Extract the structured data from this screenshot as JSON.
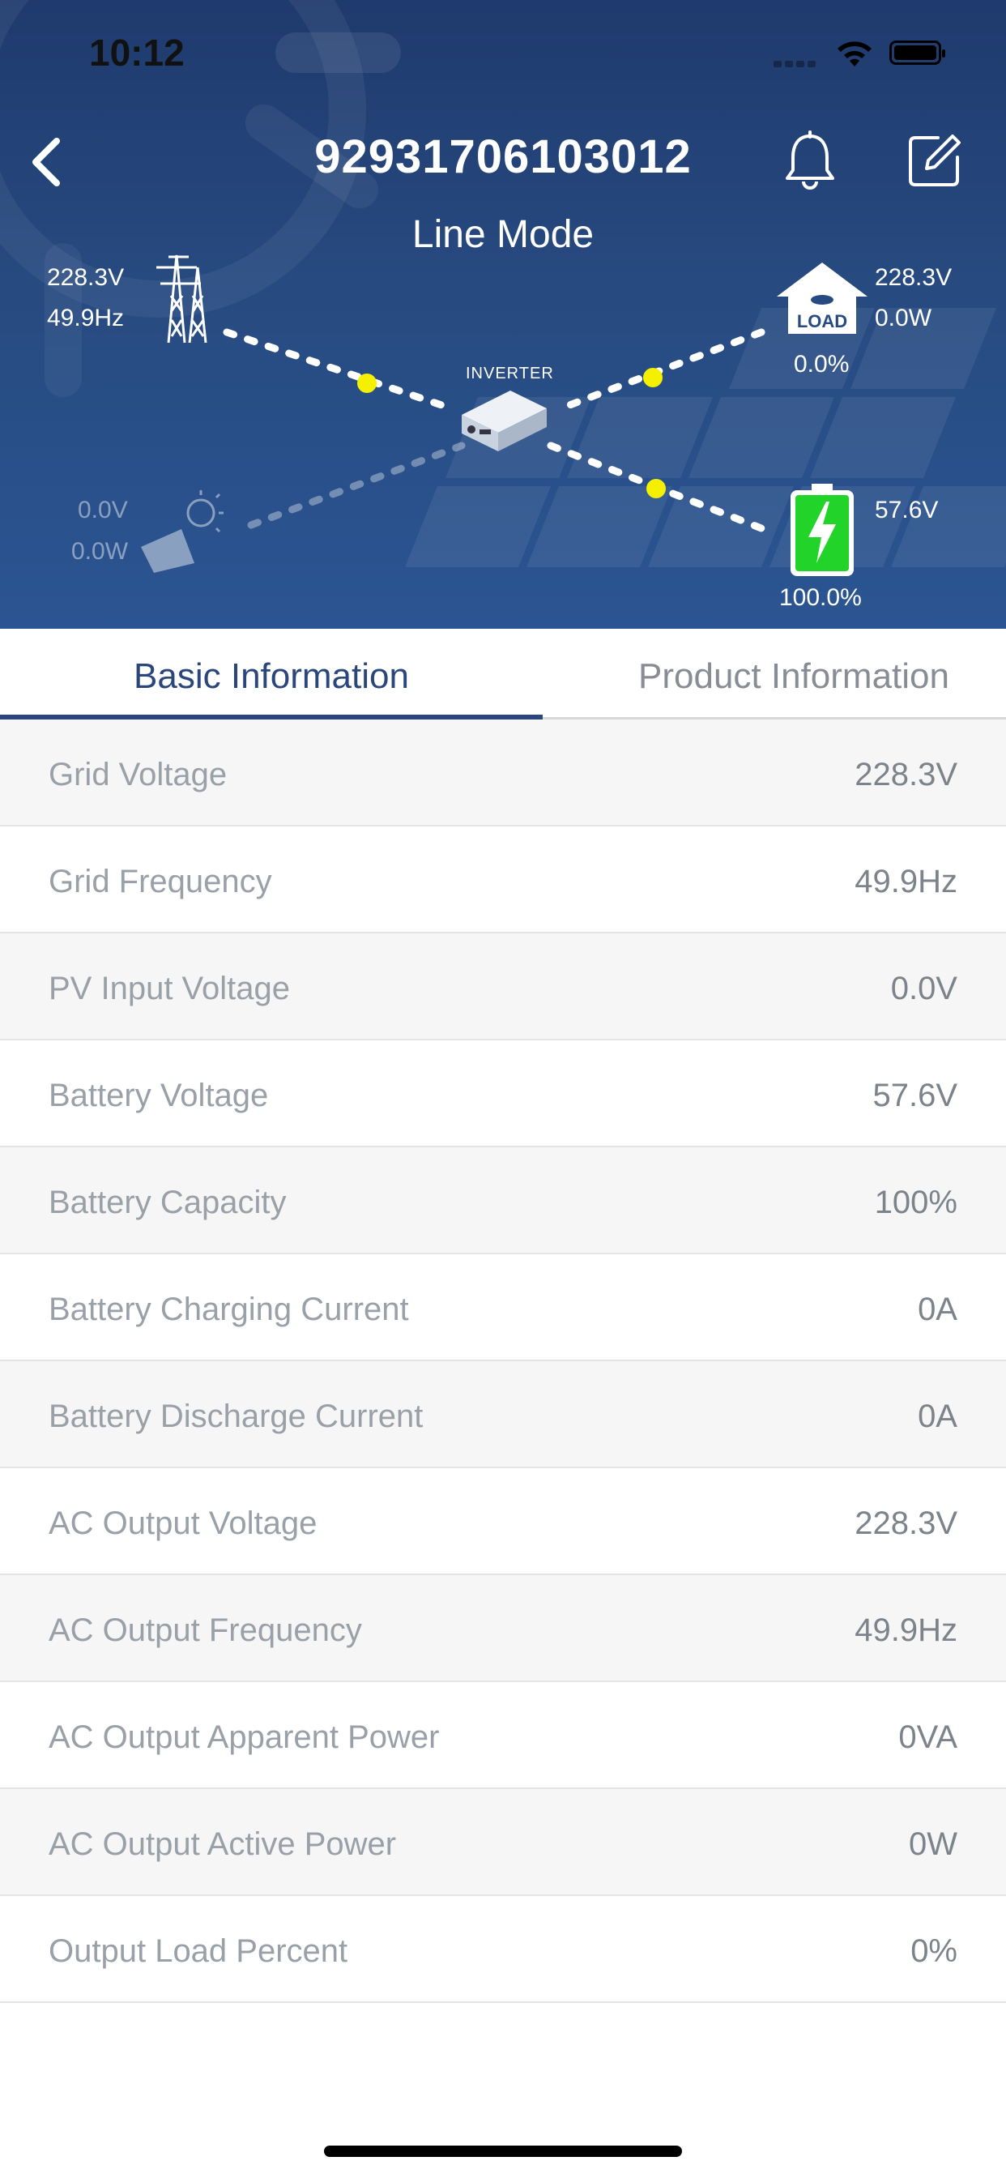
{
  "status_bar": {
    "time": "10:12"
  },
  "header": {
    "title": "92931706103012",
    "mode": "Line Mode",
    "colors": {
      "background": "#274a80",
      "flow_dot": "#f5f000",
      "battery_fill": "#22d42a"
    }
  },
  "diagram": {
    "grid": {
      "voltage": "228.3V",
      "frequency": "49.9Hz"
    },
    "load": {
      "voltage": "228.3V",
      "power": "0.0W",
      "percent": "0.0%",
      "label": "LOAD"
    },
    "inverter": {
      "label": "INVERTER"
    },
    "pv": {
      "voltage": "0.0V",
      "power": "0.0W"
    },
    "battery": {
      "voltage": "57.6V",
      "percent": "100.0%"
    }
  },
  "tabs": [
    {
      "label": "Basic Information",
      "active": true
    },
    {
      "label": "Product Information",
      "active": false
    }
  ],
  "rows": [
    {
      "label": "Grid Voltage",
      "value": "228.3V"
    },
    {
      "label": "Grid Frequency",
      "value": "49.9Hz"
    },
    {
      "label": "PV Input Voltage",
      "value": "0.0V"
    },
    {
      "label": "Battery Voltage",
      "value": "57.6V"
    },
    {
      "label": "Battery Capacity",
      "value": "100%"
    },
    {
      "label": "Battery Charging Current",
      "value": "0A"
    },
    {
      "label": "Battery Discharge Current",
      "value": "0A"
    },
    {
      "label": "AC Output Voltage",
      "value": "228.3V"
    },
    {
      "label": "AC Output Frequency",
      "value": "49.9Hz"
    },
    {
      "label": "AC Output Apparent Power",
      "value": "0VA"
    },
    {
      "label": "AC Output Active Power",
      "value": "0W"
    },
    {
      "label": "Output Load Percent",
      "value": "0%"
    }
  ],
  "icons": [
    "chevron-left-icon",
    "bell-icon",
    "edit-icon",
    "power-tower-icon",
    "house-load-icon",
    "inverter-icon",
    "solar-panel-icon",
    "battery-icon",
    "wifi-icon"
  ]
}
